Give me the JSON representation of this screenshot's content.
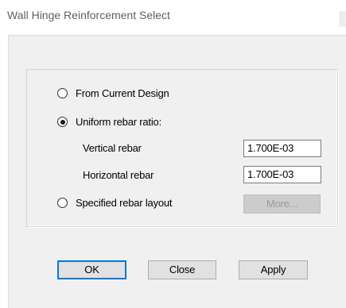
{
  "window": {
    "title": "Wall Hinge Reinforcement Select"
  },
  "options": {
    "from_current_design": {
      "label": "From Current Design",
      "selected": false
    },
    "uniform_rebar_ratio": {
      "label": "Uniform rebar ratio:",
      "selected": true
    },
    "specified_rebar_layout": {
      "label": "Specified rebar layout",
      "selected": false
    }
  },
  "fields": {
    "vertical_rebar": {
      "label": "Vertical rebar",
      "value": "1.700E-03"
    },
    "horizontal_rebar": {
      "label": "Horizontal rebar",
      "value": "1.700E-03"
    }
  },
  "buttons": {
    "more": "More...",
    "ok": "OK",
    "close": "Close",
    "apply": "Apply"
  }
}
